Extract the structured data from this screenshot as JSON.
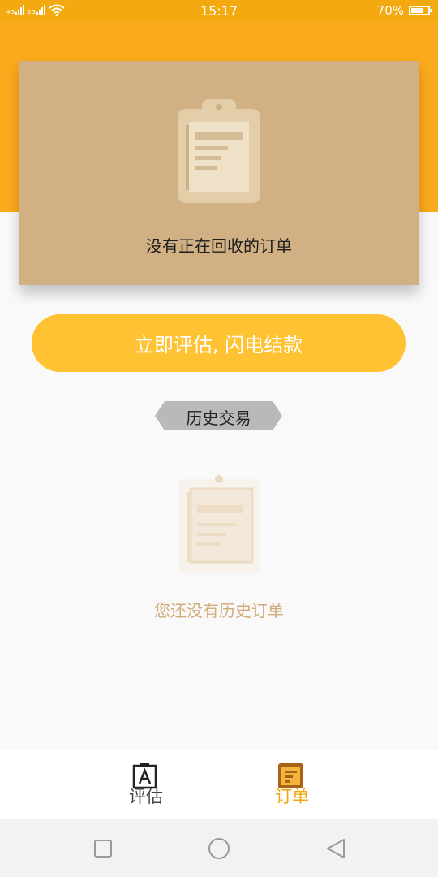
{
  "status_bar": {
    "time": "15:17",
    "battery_percent": "70%",
    "battery_level": 0.7,
    "network_labels": [
      "4G",
      "2G"
    ],
    "icons": [
      "signal-icon",
      "wifi-icon",
      "battery-icon"
    ]
  },
  "current_orders": {
    "empty_message": "没有正在回收的订单",
    "icon": "clipboard-icon"
  },
  "action_button": {
    "label": "立即评估, 闪电结款"
  },
  "history": {
    "tag_label": "历史交易",
    "empty_message": "您还没有历史订单",
    "icon": "clipboard-icon"
  },
  "tabs": [
    {
      "label": "评估",
      "icon": "estimate-icon",
      "active": false
    },
    {
      "label": "订单",
      "icon": "orders-icon",
      "active": true
    }
  ],
  "nav_bar": {
    "icons": [
      "recent-apps-icon",
      "home-icon",
      "back-icon"
    ]
  },
  "colors": {
    "header_orange": "#fbaa1b",
    "card_tan": "#d1b083",
    "button_yellow": "#ffc233",
    "active_tab": "#f2a712",
    "empty_text": "#d1ab78"
  }
}
